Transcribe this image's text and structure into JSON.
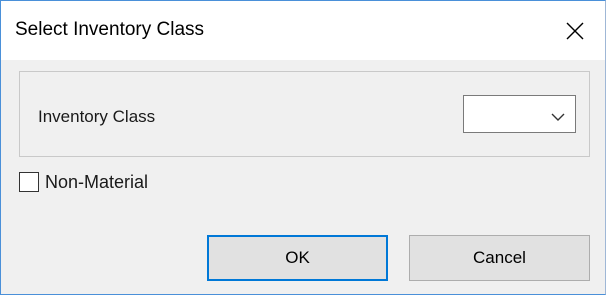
{
  "dialog": {
    "title": "Select Inventory Class",
    "close_icon": "close-icon"
  },
  "group": {
    "field_label": "Inventory Class",
    "select": {
      "value": "",
      "icon": "chevron-down-icon"
    }
  },
  "non_material": {
    "label": "Non-Material",
    "checked": false
  },
  "buttons": {
    "ok_label": "OK",
    "cancel_label": "Cancel"
  },
  "colors": {
    "accent": "#0078d7",
    "window_border": "#4a90d9",
    "dialog_bg": "#f0f0f0"
  }
}
